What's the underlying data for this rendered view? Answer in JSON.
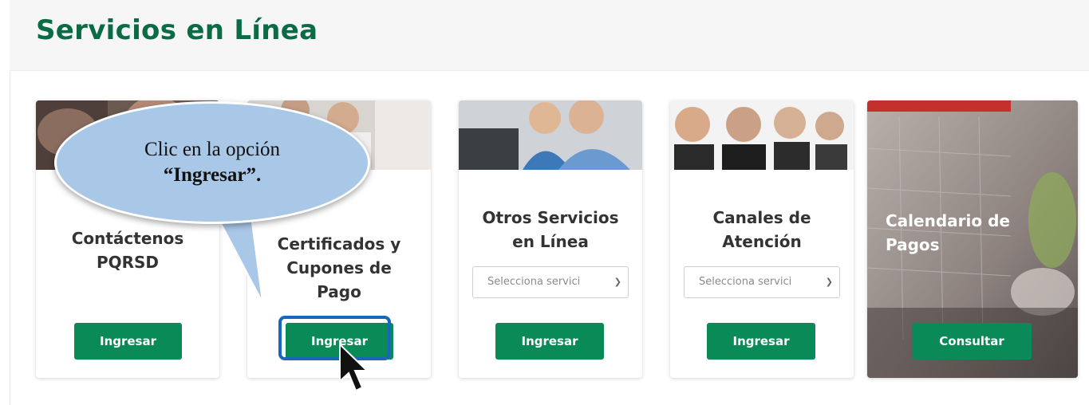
{
  "page": {
    "title": "Servicios en Línea"
  },
  "cards": [
    {
      "title": "Contáctenos PQRSD",
      "button": "Ingresar"
    },
    {
      "title": "Certificados y Cupones de Pago",
      "button": "Ingresar"
    },
    {
      "title": "Otros Servicios en Línea",
      "select_placeholder": "Selecciona servici",
      "button": "Ingresar"
    },
    {
      "title": "Canales de Atención",
      "select_placeholder": "Selecciona servici",
      "button": "Ingresar"
    },
    {
      "title": "Calendario de Pagos",
      "button": "Consultar"
    }
  ],
  "callout": {
    "line1": "Clic en la opción",
    "line2": "“Ingresar”."
  },
  "colors": {
    "brand_green": "#0a6b45",
    "button_green": "#0a8a57",
    "callout_blue": "#a9c7e6",
    "highlight_blue": "#1a66b8"
  }
}
